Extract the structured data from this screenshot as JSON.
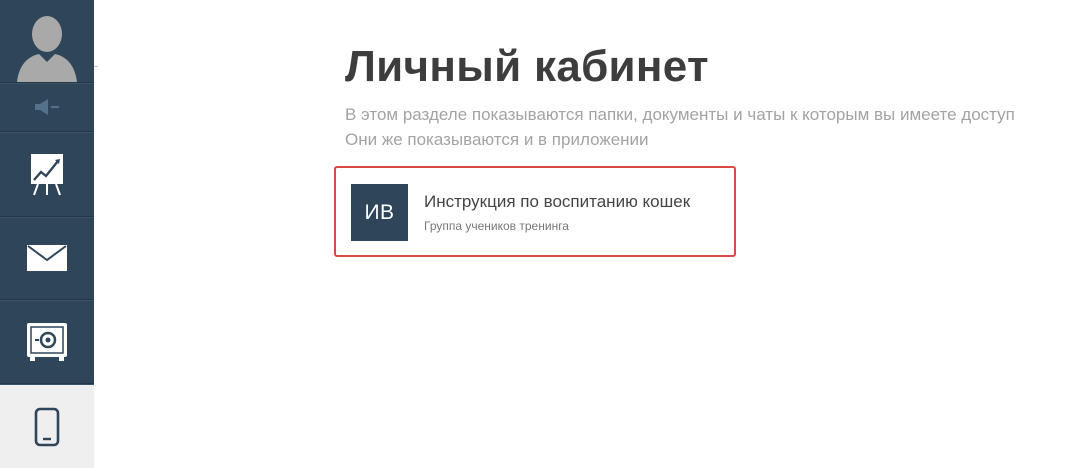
{
  "sidebar": {
    "items": [
      {
        "id": "profile",
        "icon": "user-avatar-icon"
      },
      {
        "id": "sound",
        "icon": "speaker-icon"
      },
      {
        "id": "analytics",
        "icon": "presentation-chart-icon"
      },
      {
        "id": "messages",
        "icon": "envelope-icon"
      },
      {
        "id": "safe",
        "icon": "safe-icon"
      },
      {
        "id": "mobile",
        "icon": "smartphone-icon",
        "active": true
      }
    ],
    "colors": {
      "background": "#2f4559",
      "active_background": "#efefef",
      "icon": "#ffffff"
    }
  },
  "main": {
    "title": "Личный кабинет",
    "description_line1": "В этом разделе показываются папки, документы и чаты к которым вы имеете доступ",
    "description_line2": "Они же показываются и в приложении"
  },
  "groups": [
    {
      "initials": "ИВ",
      "title": "Инструкция по воспитанию кошек",
      "subtitle": "Группа учеников тренинга",
      "highlighted": true
    }
  ],
  "colors": {
    "highlight_border": "#d94a43",
    "title_text": "#3d3d3d",
    "muted_text": "#a3a3a3",
    "avatar_background": "#2f4559"
  }
}
